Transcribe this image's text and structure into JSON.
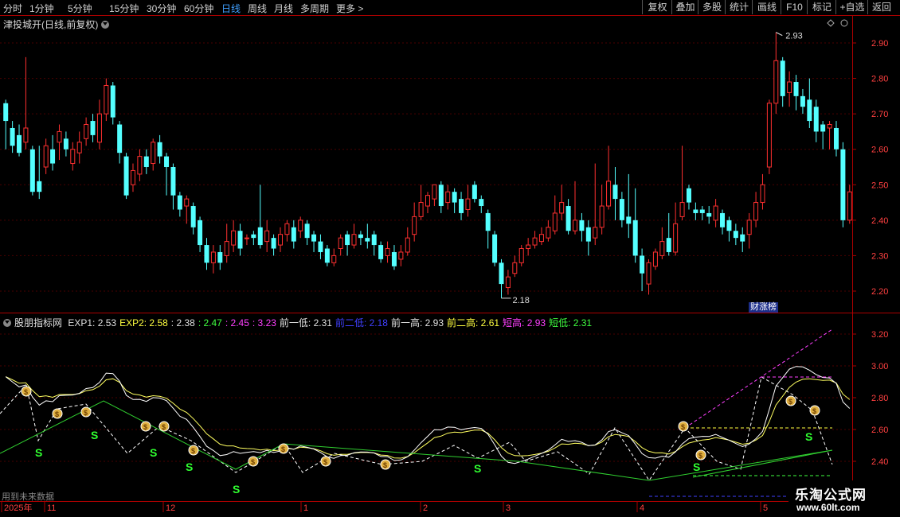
{
  "toolbar": {
    "periods": [
      "分时",
      "1分钟",
      "5分钟",
      "15分钟",
      "30分钟",
      "60分钟",
      "日线",
      "周线",
      "月线",
      "多周期",
      "更多"
    ],
    "active_period": "日线",
    "right_buttons": [
      "复权",
      "叠加",
      "多股",
      "统计",
      "画线",
      "F10",
      "标记",
      "+自选",
      "返回"
    ]
  },
  "chart": {
    "stock_title": "津投城开(日线,前复权)",
    "price_axis": [
      "2.90",
      "2.80",
      "2.70",
      "2.60",
      "2.50",
      "2.40",
      "2.30",
      "2.20"
    ],
    "high_marker": "2.93",
    "low_marker": "2.18",
    "badge": "财涨榜",
    "colors": {
      "up": "#ff3030",
      "down": "#54ffff",
      "grid": "#4a0000",
      "axis": "#aa0000"
    }
  },
  "indicator": {
    "name": "股朋指标网",
    "values": [
      {
        "text": "EXP1: 2.53",
        "color": "#e0e0e0"
      },
      {
        "text": "EXP2: 2.58",
        "color": "#ffff40"
      },
      {
        "text": ": 2.38",
        "color": "#e0e0e0"
      },
      {
        "text": ": 2.47",
        "color": "#40ff40"
      },
      {
        "text": ": 2.45",
        "color": "#ff40ff"
      },
      {
        "text": ": 3.23",
        "color": "#ff40ff"
      },
      {
        "text": "前一低: 2.31",
        "color": "#e0e0e0"
      },
      {
        "text": "前二低: 2.18",
        "color": "#4040ff"
      },
      {
        "text": "前一高: 2.93",
        "color": "#e0e0e0"
      },
      {
        "text": "前二高: 2.61",
        "color": "#ffff40"
      },
      {
        "text": "短高: 2.93",
        "color": "#ff40ff"
      },
      {
        "text": "短低: 2.31",
        "color": "#40ff40"
      }
    ],
    "axis": [
      "3.20",
      "3.00",
      "2.80",
      "2.60",
      "2.40"
    ],
    "future_label": "用到未来数据"
  },
  "time_axis": [
    "2025年",
    "11",
    "12",
    "1",
    "2",
    "3",
    "4",
    "5"
  ],
  "watermark": {
    "title": "乐淘公式网",
    "url": "www.60lt.com"
  }
}
